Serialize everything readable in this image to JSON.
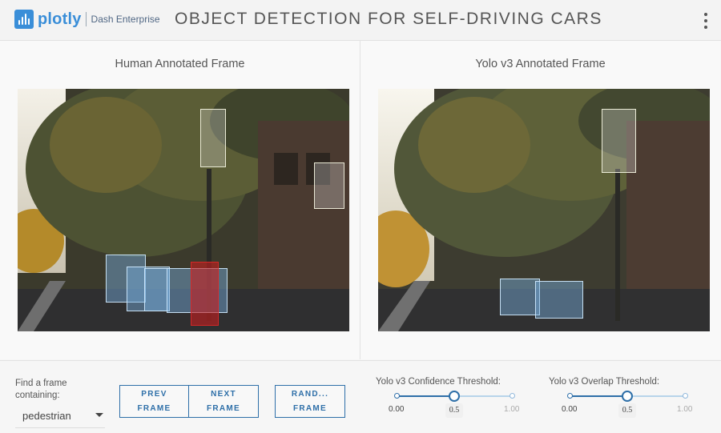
{
  "header": {
    "logo_word": "plotly",
    "logo_sub": "Dash Enterprise",
    "title": "OBJECT DETECTION FOR SELF-DRIVING CARS",
    "menu_icon": "vertical-ellipsis-icon"
  },
  "panels": {
    "left": {
      "title": "Human Annotated Frame",
      "boxes": [
        {
          "label": "car",
          "color": "#78afe1"
        },
        {
          "label": "car",
          "color": "#78afe1"
        },
        {
          "label": "car",
          "color": "#78afe1"
        },
        {
          "label": "car",
          "color": "#78afe1"
        },
        {
          "label": "pedestrian",
          "color": "#c81e1e"
        },
        {
          "label": "traffic light",
          "color": "#ffffff"
        },
        {
          "label": "sign",
          "color": "#ffffff"
        }
      ]
    },
    "right": {
      "title": "Yolo v3 Annotated Frame",
      "boxes": [
        {
          "label": "car",
          "color": "#78afe1"
        },
        {
          "label": "car",
          "color": "#78afe1"
        },
        {
          "label": "traffic light",
          "color": "#ffffff"
        }
      ]
    }
  },
  "controls": {
    "find_label": "Find a frame containing:",
    "dropdown_value": "pedestrian",
    "buttons": {
      "prev": [
        "PREV",
        "FRAME"
      ],
      "next": [
        "NEXT",
        "FRAME"
      ],
      "random": [
        "RAND...",
        "FRAME"
      ]
    },
    "confidence": {
      "label": "Yolo v3 Confidence Threshold:",
      "min": "0.00",
      "max": "1.00",
      "value": "0.5",
      "fraction": 0.5
    },
    "overlap": {
      "label": "Yolo v3 Overlap Threshold:",
      "min": "0.00",
      "max": "1.00",
      "value": "0.5",
      "fraction": 0.5
    }
  },
  "colors": {
    "accent": "#2e6fa8",
    "logo": "#3a8ed8"
  }
}
